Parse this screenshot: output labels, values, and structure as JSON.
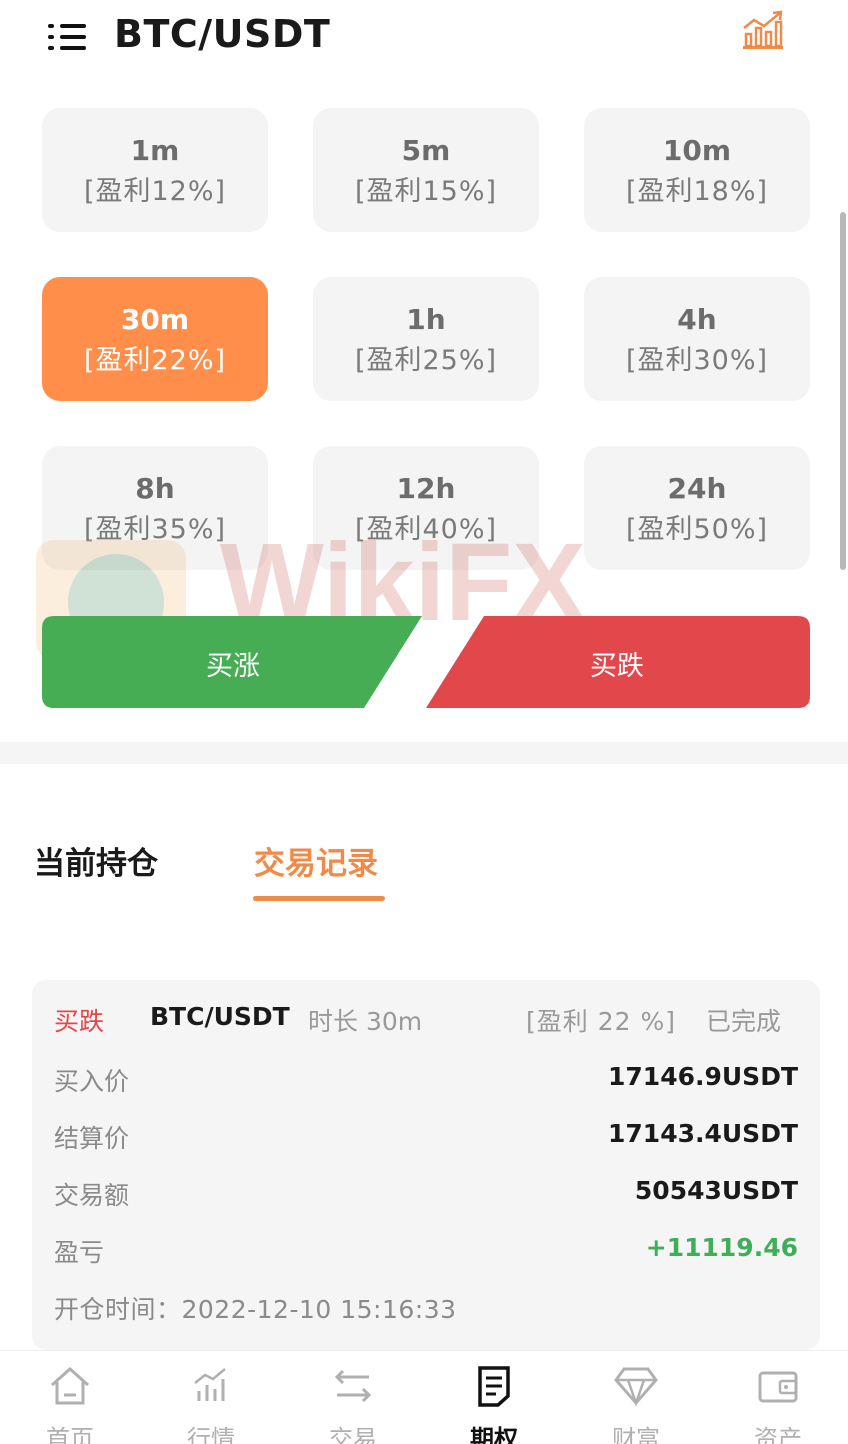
{
  "header": {
    "title": "BTC/USDT"
  },
  "periods": [
    {
      "label": "1m",
      "profit": "[盈利12%]"
    },
    {
      "label": "5m",
      "profit": "[盈利15%]"
    },
    {
      "label": "10m",
      "profit": "[盈利18%]"
    },
    {
      "label": "30m",
      "profit": "[盈利22%]"
    },
    {
      "label": "1h",
      "profit": "[盈利25%]"
    },
    {
      "label": "4h",
      "profit": "[盈利30%]"
    },
    {
      "label": "8h",
      "profit": "[盈利35%]"
    },
    {
      "label": "12h",
      "profit": "[盈利40%]"
    },
    {
      "label": "24h",
      "profit": "[盈利50%]"
    }
  ],
  "selected_period": "30m",
  "actions": {
    "buy_up": "买涨",
    "buy_down": "买跌"
  },
  "tabs": {
    "current": "当前持仓",
    "records": "交易记录"
  },
  "record": {
    "direction": "买跌",
    "pair": "BTC/USDT",
    "duration": "时长 30m",
    "profit_rate": "[盈利 22 %]",
    "status": "已完成",
    "rows": [
      {
        "label": "买入价",
        "value": "17146.9USDT"
      },
      {
        "label": "结算价",
        "value": "17143.4USDT"
      },
      {
        "label": "交易额",
        "value": "50543USDT"
      },
      {
        "label": "盈亏",
        "value": "+11119.46"
      }
    ],
    "open_time": "开仓时间：2022-12-10 15:16:33"
  },
  "nav": [
    {
      "label": "首页",
      "icon": "home-icon"
    },
    {
      "label": "行情",
      "icon": "market-chart-icon"
    },
    {
      "label": "交易",
      "icon": "exchange-arrows-icon"
    },
    {
      "label": "期权",
      "icon": "document-icon"
    },
    {
      "label": "财富",
      "icon": "diamond-icon"
    },
    {
      "label": "资产",
      "icon": "wallet-icon"
    }
  ],
  "active_nav": "期权",
  "watermark": "WikiFX",
  "colors": {
    "accent_orange": "#ff8e4a",
    "buy_up_green": "#46ad54",
    "buy_down_red": "#e2474b",
    "gain_green": "#3fae5a"
  }
}
